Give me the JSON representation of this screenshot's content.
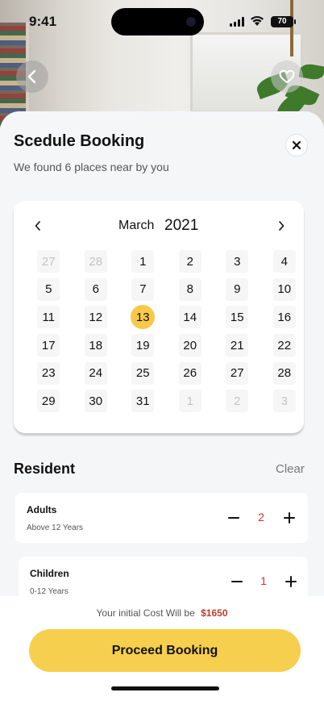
{
  "status_bar": {
    "time": "9:41",
    "battery": "70"
  },
  "header": {
    "back_icon": "chevron-left-icon",
    "favorite_icon": "heart-icon"
  },
  "sheet": {
    "title": "Scedule Booking",
    "subtitle": "We found 6 places near by you",
    "close_icon": "close-icon"
  },
  "calendar": {
    "month": "March",
    "year": "2021",
    "selected": "13",
    "days": [
      {
        "n": "27",
        "muted": true
      },
      {
        "n": "28",
        "muted": true
      },
      {
        "n": "1"
      },
      {
        "n": "2"
      },
      {
        "n": "3"
      },
      {
        "n": "4"
      },
      {
        "n": "5"
      },
      {
        "n": "6"
      },
      {
        "n": "7"
      },
      {
        "n": "8"
      },
      {
        "n": "9"
      },
      {
        "n": "10"
      },
      {
        "n": "11"
      },
      {
        "n": "12"
      },
      {
        "n": "13",
        "selected": true
      },
      {
        "n": "14"
      },
      {
        "n": "15"
      },
      {
        "n": "16"
      },
      {
        "n": "17"
      },
      {
        "n": "18"
      },
      {
        "n": "19"
      },
      {
        "n": "20"
      },
      {
        "n": "21"
      },
      {
        "n": "22"
      },
      {
        "n": "23"
      },
      {
        "n": "24"
      },
      {
        "n": "25"
      },
      {
        "n": "26"
      },
      {
        "n": "27"
      },
      {
        "n": "28"
      },
      {
        "n": "29"
      },
      {
        "n": "30"
      },
      {
        "n": "31"
      },
      {
        "n": "1",
        "muted": true
      },
      {
        "n": "2",
        "muted": true
      },
      {
        "n": "3",
        "muted": true
      }
    ]
  },
  "resident": {
    "title": "Resident",
    "clear_label": "Clear",
    "adults": {
      "label": "Adults",
      "description": "Above 12 Years",
      "count": "2"
    },
    "children": {
      "label": "Children",
      "description": "0-12 Years",
      "count": "1"
    }
  },
  "footer": {
    "cost_label": "Your initial Cost Will be",
    "cost_amount": "$1650",
    "proceed_label": "Proceed Booking"
  },
  "colors": {
    "accent": "#f7cf4e",
    "selected_day": "#f7c948",
    "count_red": "#c0392b"
  }
}
